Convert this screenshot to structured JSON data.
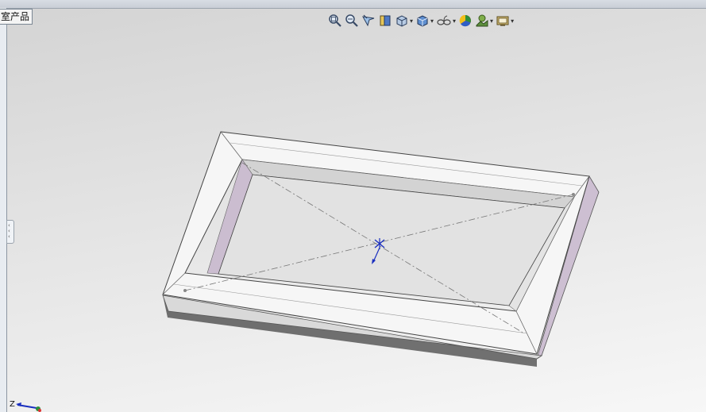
{
  "window": {
    "top_fragment_1": "",
    "top_fragment_2": "",
    "product_tab_label": "室产品"
  },
  "toolbar": {
    "items": [
      {
        "icon": "zoom-to-fit-icon",
        "dropdown": false
      },
      {
        "icon": "zoom-to-area-icon",
        "dropdown": false
      },
      {
        "icon": "previous-view-icon",
        "dropdown": false
      },
      {
        "icon": "section-view-icon",
        "dropdown": false
      },
      {
        "icon": "view-orientation-icon",
        "dropdown": true
      },
      {
        "icon": "display-style-icon",
        "dropdown": true
      },
      {
        "icon": "hide-show-items-icon",
        "dropdown": true
      },
      {
        "icon": "edit-appearance-icon",
        "dropdown": false
      },
      {
        "icon": "apply-scene-icon",
        "dropdown": true
      },
      {
        "icon": "view-settings-icon",
        "dropdown": true
      }
    ]
  },
  "triad": {
    "z_label": "Z"
  },
  "colors": {
    "frame_top": "#f5f5f5",
    "frame_inner_wall": "#cfc6d3",
    "frame_dark_edge": "#3a3a3a",
    "origin_marker": "#1a2fbf"
  }
}
